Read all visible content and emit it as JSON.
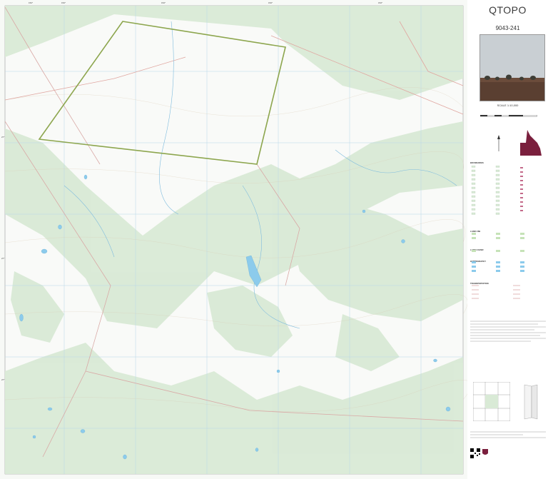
{
  "title": "QTOPO",
  "sheet_id": "9043-241",
  "scale": "SCALE 1:10,000",
  "legend": {
    "sections": [
      "BOUNDARIES",
      "LAND USE",
      "LAND COVER",
      "HYDROGRAPHY",
      "TRANSPORTATION"
    ]
  },
  "colors": {
    "vegetation": "#d9ead6",
    "water": "#8ccbec",
    "boundary": "#8da64e",
    "road": "#d9a9a6",
    "grid": "#b7d6e8",
    "queensland_map": "#7a1f3d"
  },
  "icons": [
    "compass-icon",
    "qr-code-icon",
    "queensland-crest-icon",
    "queensland-locality-map-icon"
  ]
}
